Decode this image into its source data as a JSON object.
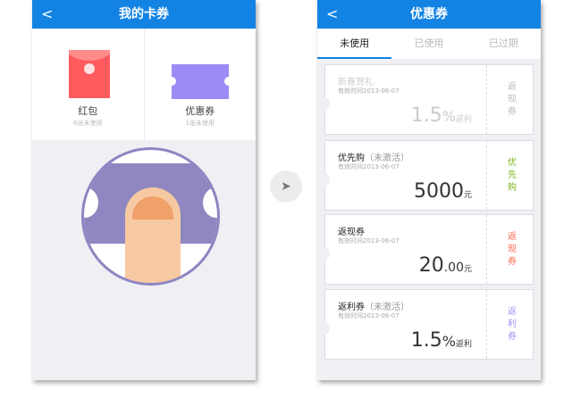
{
  "left_screen": {
    "back_icon": "chevron-left",
    "title": "我的卡券",
    "cards": [
      {
        "name": "红包",
        "sub": "6张未使用",
        "icon": "red-envelope"
      },
      {
        "name": "优惠券",
        "sub": "1张未使用",
        "icon": "ticket"
      }
    ]
  },
  "arrow_icon": "arrow-right",
  "right_screen": {
    "back_icon": "chevron-left",
    "title": "优惠券",
    "tabs": [
      "未使用",
      "已使用",
      "已过期"
    ],
    "active_tab": 0,
    "coupons": [
      {
        "title": "新春贺礼",
        "status": "",
        "date": "有效时间2013-06-07",
        "value": "1.5",
        "unit": "%",
        "unit2": "返利",
        "type": "返现券",
        "type_color": "#bbbbbb"
      },
      {
        "title": "优先购",
        "status": "（未激活）",
        "date": "有效时间2013-06-07",
        "value": "5000",
        "unit": "",
        "unit2": "元",
        "type": "优先购",
        "type_color": "#7ab51d"
      },
      {
        "title": "返现券",
        "status": "",
        "date": "有效时间2013-06-07",
        "value": "20",
        "unit": ".00",
        "unit2": "元",
        "type": "返现券",
        "type_color": "#ff6a4d"
      },
      {
        "title": "返利券",
        "status": "（未激活）",
        "date": "有效时间2013-06-07",
        "value": "1.5",
        "unit": "%",
        "unit2": "返利",
        "type": "返利券",
        "type_color": "#a48ef5"
      }
    ]
  },
  "colors": {
    "header": "#1283e3",
    "background": "#efeff4"
  }
}
